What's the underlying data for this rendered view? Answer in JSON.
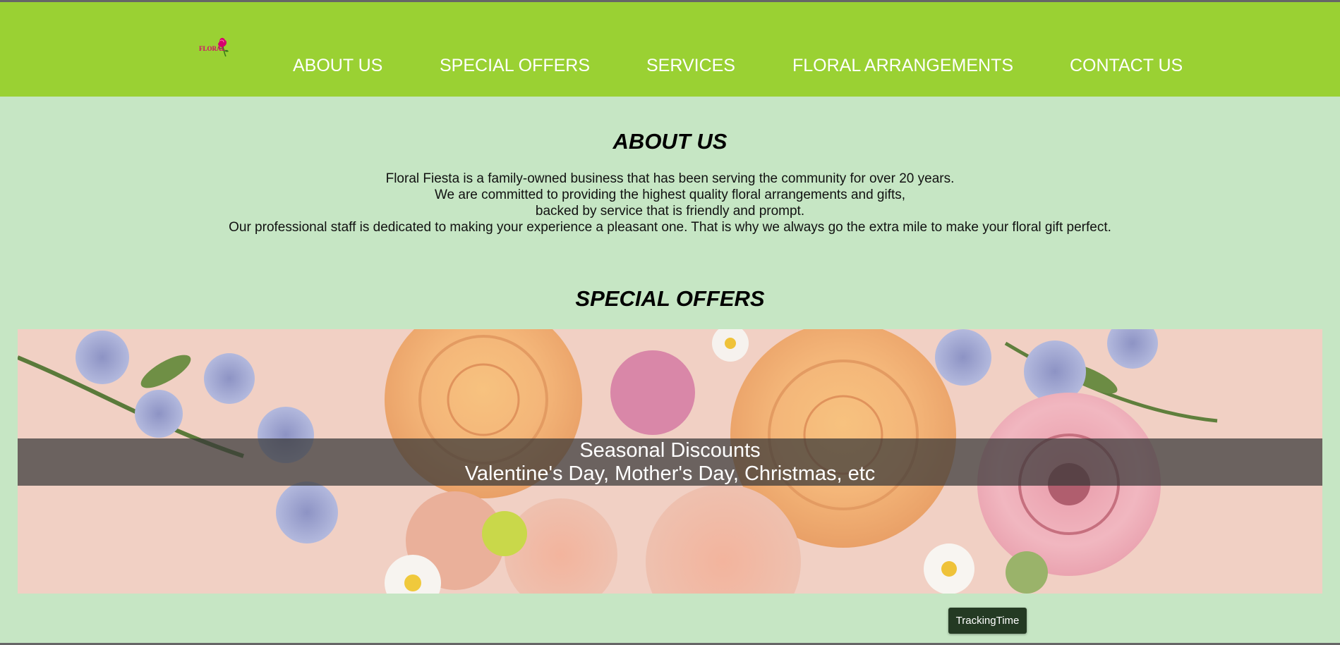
{
  "logo": {
    "text": "FLORAL",
    "icon": "rose-icon"
  },
  "nav": {
    "items": [
      {
        "label": "ABOUT US"
      },
      {
        "label": "SPECIAL OFFERS"
      },
      {
        "label": "SERVICES"
      },
      {
        "label": "FLORAL ARRANGEMENTS"
      },
      {
        "label": "CONTACT US"
      }
    ]
  },
  "about": {
    "title": "ABOUT US",
    "lines": [
      "Floral Fiesta is a family-owned business that has been serving the community for over 20 years.",
      "We are committed to providing the highest quality floral arrangements and gifts,",
      "backed by service that is friendly and prompt.",
      "Our professional staff is dedicated to making your experience a pleasant one. That is why we always go the extra mile to make your floral gift perfect."
    ]
  },
  "offers": {
    "title": "SPECIAL OFFERS",
    "slide": {
      "title": "Seasonal Discounts",
      "subtitle": "Valentine's Day, Mother's Day, Christmas, etc"
    }
  },
  "tracking": {
    "label": "TrackingTime"
  },
  "colors": {
    "header_bg": "#9ad133",
    "page_bg": "#c6e6c4",
    "nav_text": "#ffffff",
    "logo_accent": "#d6006d",
    "tracking_bg": "#243a23"
  }
}
